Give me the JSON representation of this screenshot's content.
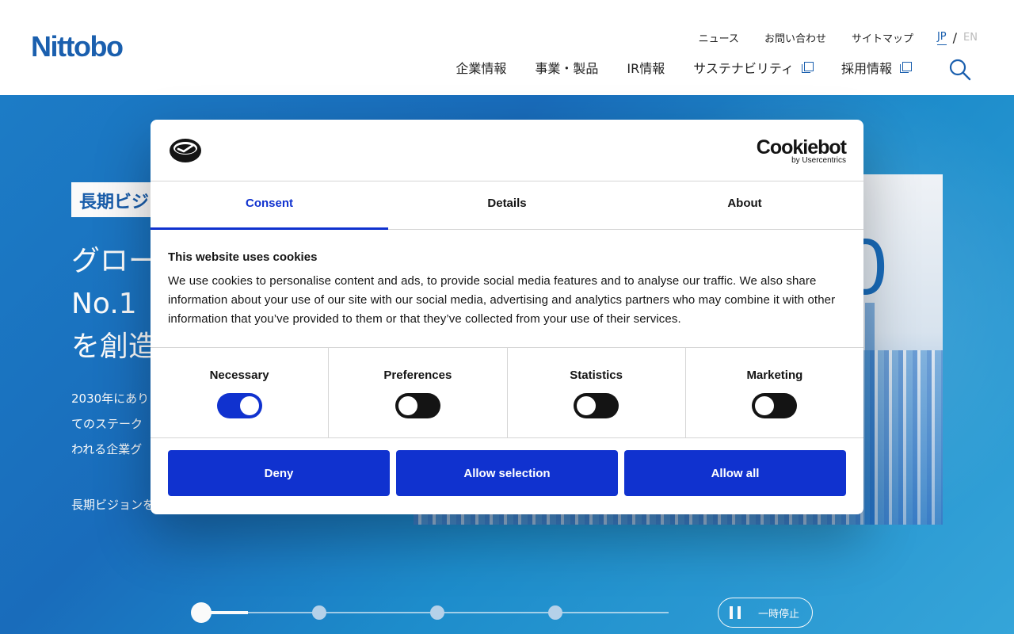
{
  "header": {
    "logo": "Nittobo",
    "util_nav": [
      "ニュース",
      "お問い合わせ",
      "サイトマップ"
    ],
    "lang": {
      "jp": "JP",
      "separator": "/",
      "en": "EN"
    },
    "main_nav": [
      {
        "label": "企業情報",
        "external": false
      },
      {
        "label": "事業・製品",
        "external": false
      },
      {
        "label": "IR情報",
        "external": false
      },
      {
        "label": "サステナビリティ",
        "external": true
      },
      {
        "label": "採用情報",
        "external": true
      }
    ],
    "search_icon": "search-icon"
  },
  "hero": {
    "tag": "長期ビジ",
    "title_lines": [
      "グロー",
      "No.1",
      "を創造"
    ],
    "body_lines": [
      "2030年にあり",
      "てのステーク",
      "われる企業グ"
    ],
    "link": "長期ビジョンを",
    "image_number": "0",
    "slider": {
      "slides": 5,
      "active": 1,
      "progress": 0.1
    },
    "pause_label": "一時停止"
  },
  "cookie_dialog": {
    "brand": "Cookiebot",
    "brand_by": "by Usercentrics",
    "tabs": [
      "Consent",
      "Details",
      "About"
    ],
    "active_tab": "Consent",
    "heading": "This website uses cookies",
    "body": "We use cookies to personalise content and ads, to provide social media features and to analyse our traffic. We also share information about your use of our site with our social media, advertising and analytics partners who may combine it with other information that you’ve provided to them or that they’ve collected from your use of their services.",
    "categories": [
      {
        "label": "Necessary",
        "enabled": true
      },
      {
        "label": "Preferences",
        "enabled": false
      },
      {
        "label": "Statistics",
        "enabled": false
      },
      {
        "label": "Marketing",
        "enabled": false
      }
    ],
    "buttons": {
      "deny": "Deny",
      "allow_selection": "Allow selection",
      "allow_all": "Allow all"
    },
    "colors": {
      "accent": "#1032cf",
      "brand_blue": "#1a5fae"
    }
  }
}
